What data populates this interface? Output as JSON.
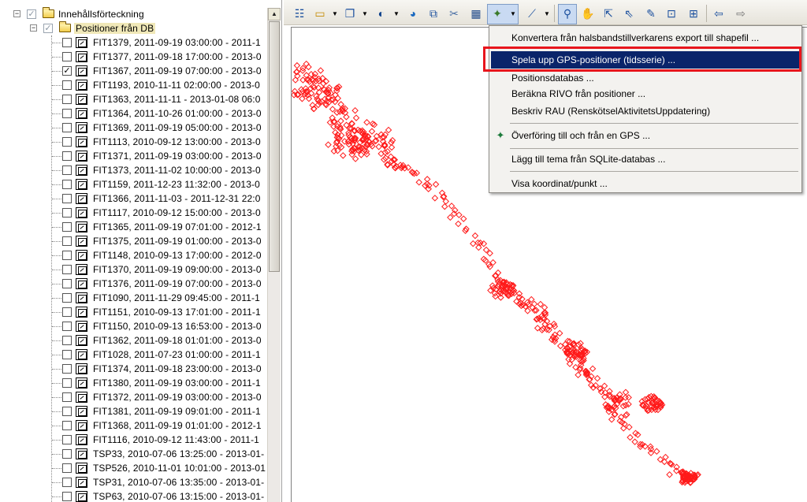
{
  "toc": {
    "root_label": "Innehållsförteckning",
    "group_label": "Positioner från DB",
    "layers": [
      {
        "label": "FIT1379, 2011-09-19 03:00:00 - 2011-1",
        "checked": false
      },
      {
        "label": "FIT1377, 2011-09-18 17:00:00 - 2013-0",
        "checked": false
      },
      {
        "label": "FIT1367, 2011-09-19 07:00:00 - 2013-0",
        "checked": true
      },
      {
        "label": "FIT1193, 2010-11-11 02:00:00 - 2013-0",
        "checked": false
      },
      {
        "label": "FIT1363, 2011-11-11 - 2013-01-08 06:0",
        "checked": false
      },
      {
        "label": "FIT1364, 2011-10-26 01:00:00 - 2013-0",
        "checked": false
      },
      {
        "label": "FIT1369, 2011-09-19 05:00:00 - 2013-0",
        "checked": false
      },
      {
        "label": "FIT1113, 2010-09-12 13:00:00 - 2013-0",
        "checked": false
      },
      {
        "label": "FIT1371, 2011-09-19 03:00:00 - 2013-0",
        "checked": false
      },
      {
        "label": "FIT1373, 2011-11-02 10:00:00 - 2013-0",
        "checked": false
      },
      {
        "label": "FIT1159, 2011-12-23 11:32:00 - 2013-0",
        "checked": false
      },
      {
        "label": "FIT1366, 2011-11-03 - 2011-12-31 22:0",
        "checked": false
      },
      {
        "label": "FIT1117, 2010-09-12 15:00:00 - 2013-0",
        "checked": false
      },
      {
        "label": "FIT1365, 2011-09-19 07:01:00 - 2012-1",
        "checked": false
      },
      {
        "label": "FIT1375, 2011-09-19 01:00:00 - 2013-0",
        "checked": false
      },
      {
        "label": "FIT1148, 2010-09-13 17:00:00 - 2012-0",
        "checked": false
      },
      {
        "label": "FIT1370, 2011-09-19 09:00:00 - 2013-0",
        "checked": false
      },
      {
        "label": "FIT1376, 2011-09-19 07:00:00 - 2013-0",
        "checked": false
      },
      {
        "label": "FIT1090, 2011-11-29 09:45:00 - 2011-1",
        "checked": false
      },
      {
        "label": "FIT1151, 2010-09-13 17:01:00 - 2011-1",
        "checked": false
      },
      {
        "label": "FIT1150, 2010-09-13 16:53:00 - 2013-0",
        "checked": false
      },
      {
        "label": "FIT1362, 2011-09-18 01:01:00 - 2013-0",
        "checked": false
      },
      {
        "label": "FIT1028, 2011-07-23 01:00:00 - 2011-1",
        "checked": false
      },
      {
        "label": "FIT1374, 2011-09-18 23:00:00 - 2013-0",
        "checked": false
      },
      {
        "label": "FIT1380, 2011-09-19 03:00:00 - 2011-1",
        "checked": false
      },
      {
        "label": "FIT1372, 2011-09-19 03:00:00 - 2013-0",
        "checked": false
      },
      {
        "label": "FIT1381, 2011-09-19 09:01:00 - 2011-1",
        "checked": false
      },
      {
        "label": "FIT1368, 2011-09-19 01:01:00 - 2012-1",
        "checked": false
      },
      {
        "label": "FIT1116, 2010-09-12 11:43:00 - 2011-1",
        "checked": false
      },
      {
        "label": "TSP33, 2010-07-06 13:25:00 - 2013-01-",
        "checked": false
      },
      {
        "label": "TSP526, 2010-11-01 10:01:00 - 2013-01",
        "checked": false
      },
      {
        "label": "TSP31, 2010-07-06 13:35:00 - 2013-01-",
        "checked": false
      },
      {
        "label": "TSP63, 2010-07-06 13:15:00 - 2013-01-",
        "checked": false
      }
    ]
  },
  "toolbar": {
    "icons": [
      "layers-icon",
      "open-folder-icon",
      "copy-icon",
      "globe-icon",
      "world-icon",
      "export-icon",
      "tool-icon",
      "table-icon",
      "gps-icon",
      "line-icon",
      "zoom-icon",
      "pan-icon",
      "select-icon",
      "select-arrow-icon",
      "edit-icon",
      "identify-icon",
      "export-map-icon",
      "back-icon",
      "forward-icon"
    ]
  },
  "menu": {
    "items": [
      {
        "label": "Konvertera från halsbandstillverkarens export till shapefil ..."
      },
      {
        "label": "Spela upp GPS-positioner (tidsserie) ..."
      },
      {
        "label": "Positionsdatabas ..."
      },
      {
        "label": "Beräkna RIVO från positioner ..."
      },
      {
        "label": "Beskriv RAU (RenskötselAktivitetsUppdatering)"
      },
      {
        "label": "Överföring till och från en GPS ..."
      },
      {
        "label": "Lägg till tema från SQLite-databas ..."
      },
      {
        "label": "Visa koordinat/punkt ..."
      }
    ],
    "selected_index": 1
  },
  "colors": {
    "track": "#ff1a1a",
    "menu_selected_bg": "#0a246a",
    "highlight_box": "#e8151c"
  }
}
